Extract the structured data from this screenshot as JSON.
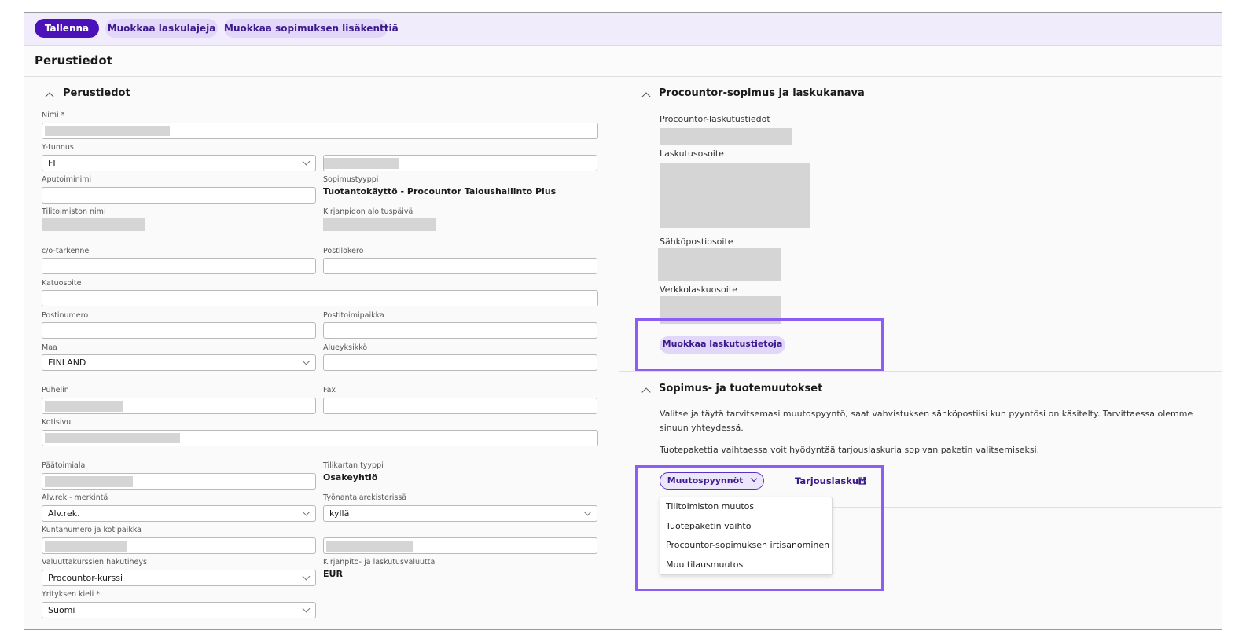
{
  "toolbar": {
    "save_label": "Tallenna",
    "edit_invoice_types_label": "Muokkaa laskulajeja",
    "edit_extra_fields_label": "Muokkaa sopimuksen lisäkenttiä"
  },
  "page": {
    "title": "Perustiedot"
  },
  "basic": {
    "title": "Perustiedot",
    "name_label": "Nimi *",
    "business_id_label": "Y-tunnus",
    "business_id_country": "FI",
    "auxiliary_name_label": "Aputoiminimi",
    "contract_type_label": "Sopimustyyppi",
    "contract_type_value": "Tuotantokäyttö - Procountor Taloushallinto Plus",
    "accounting_office_label": "Tilitoimiston nimi",
    "accounting_start_label": "Kirjanpidon aloituspäivä",
    "co_label": "c/o-tarkenne",
    "po_box_label": "Postilokero",
    "street_label": "Katuosoite",
    "postal_code_label": "Postinumero",
    "city_label": "Postitoimipaikka",
    "country_label": "Maa",
    "country_value": "FINLAND",
    "region_label": "Alueyksikkö",
    "phone_label": "Puhelin",
    "fax_label": "Fax",
    "website_label": "Kotisivu",
    "industry_label": "Päätoimiala",
    "chart_type_label": "Tilikartan tyyppi",
    "chart_type_value": "Osakeyhtiö",
    "vat_label": "Alv.rek - merkintä",
    "vat_value": "Alv.rek.",
    "employer_label": "Työnantajarekisterissä",
    "employer_value": "kyllä",
    "municipality_label": "Kuntanumero ja kotipaikka",
    "fx_label": "Valuuttakurssien hakutiheys",
    "fx_value": "Procountor-kurssi",
    "currency_label": "Kirjanpito- ja laskutusvaluutta",
    "currency_value": "EUR",
    "language_label": "Yrityksen kieli *",
    "language_value": "Suomi"
  },
  "billing": {
    "title": "Procountor-sopimus ja laskukanava",
    "billing_info_label": "Procountor-laskutustiedot",
    "billing_address_label": "Laskutusosoite",
    "email_label": "Sähköpostiosoite",
    "einvoice_label": "Verkkolaskuosoite",
    "edit_button": "Muokkaa laskutustietoja"
  },
  "changes": {
    "title": "Sopimus- ja tuotemuutokset",
    "text1": "Valitse ja täytä tarvitsemasi muutospyyntö, saat vahvistuksen sähköpostiisi kun pyyntösi on käsitelty. Tarvittaessa olemme sinuun yhteydessä.",
    "text2": "Tuotepakettia vaihtaessa voit hyödyntää tarjouslaskuria sopivan paketin valitsemiseksi.",
    "requests_button": "Muutospyynnöt",
    "calculator_link": "Tarjouslaskuri",
    "menu": [
      "Tilitoimiston muutos",
      "Tuotepaketin vaihto",
      "Procountor-sopimuksen irtisanominen",
      "Muu tilausmuutos"
    ]
  },
  "colors": {
    "accent": "#4a12b8",
    "highlight": "#8b5cf6",
    "toolbar_bg": "#f1ecfb"
  }
}
